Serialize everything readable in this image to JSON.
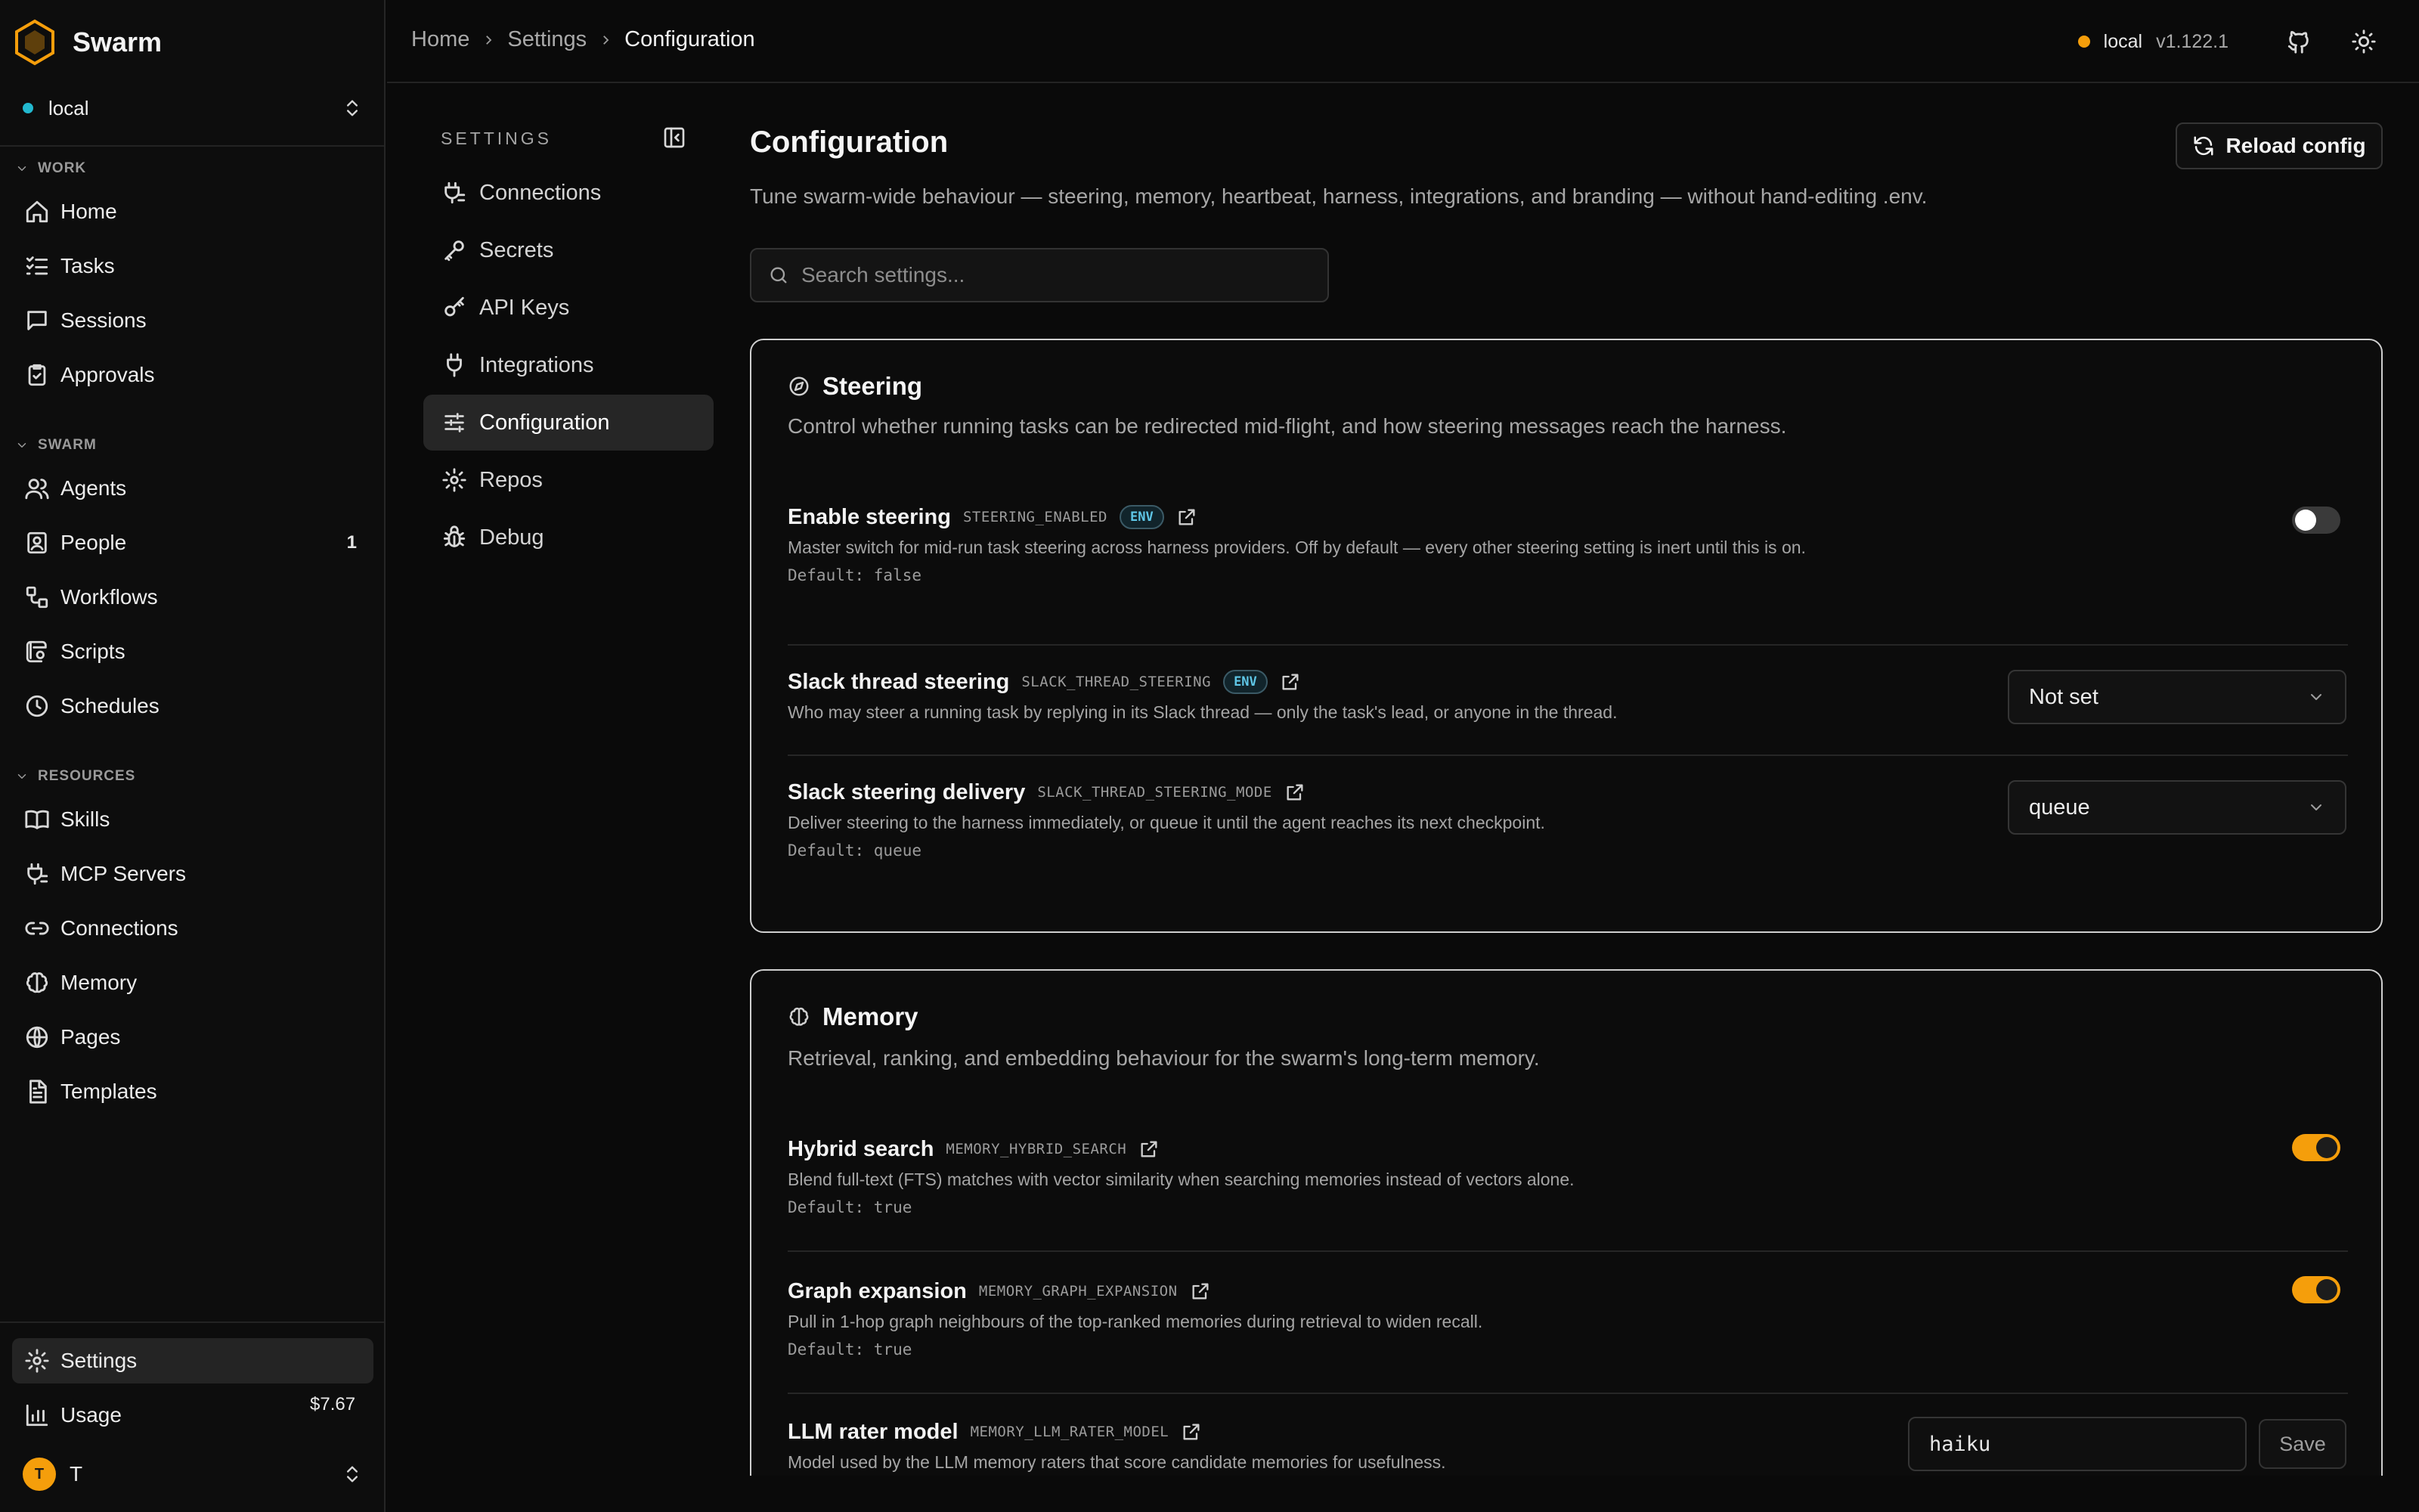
{
  "brand": {
    "name": "Swarm"
  },
  "workspace": {
    "name": "local",
    "dot_color": "#22b8cf"
  },
  "sidebar": {
    "sections": {
      "work": "WORK",
      "swarm": "SWARM",
      "resources": "RESOURCES"
    },
    "work": [
      {
        "label": "Home",
        "icon": "home-icon"
      },
      {
        "label": "Tasks",
        "icon": "tasks-icon"
      },
      {
        "label": "Sessions",
        "icon": "message-icon"
      },
      {
        "label": "Approvals",
        "icon": "clipboard-icon"
      }
    ],
    "swarm": [
      {
        "label": "Agents",
        "icon": "users-icon"
      },
      {
        "label": "People",
        "icon": "contact-icon",
        "count": "1"
      },
      {
        "label": "Workflows",
        "icon": "workflow-icon"
      },
      {
        "label": "Scripts",
        "icon": "script-icon"
      },
      {
        "label": "Schedules",
        "icon": "clock-icon"
      }
    ],
    "resources": [
      {
        "label": "Skills",
        "icon": "book-icon"
      },
      {
        "label": "MCP Servers",
        "icon": "plug-icon"
      },
      {
        "label": "Connections",
        "icon": "link-icon"
      },
      {
        "label": "Memory",
        "icon": "brain-icon"
      },
      {
        "label": "Pages",
        "icon": "globe-icon"
      },
      {
        "label": "Templates",
        "icon": "document-icon"
      }
    ],
    "bottom": {
      "settings": "Settings",
      "usage": "Usage",
      "usage_cost": "$7.67",
      "user_initial": "T",
      "user_name": "T"
    }
  },
  "topbar": {
    "breadcrumbs": [
      "Home",
      "Settings",
      "Configuration"
    ],
    "env_label": "local",
    "env_dot_color": "#f59e0b",
    "version": "v1.122.1"
  },
  "settings_nav": {
    "heading": "SETTINGS",
    "items": [
      {
        "label": "Connections",
        "icon": "plug-icon"
      },
      {
        "label": "Secrets",
        "icon": "key-icon"
      },
      {
        "label": "API Keys",
        "icon": "key-round-icon"
      },
      {
        "label": "Integrations",
        "icon": "plug-icon"
      },
      {
        "label": "Configuration",
        "icon": "sliders-icon",
        "active": true
      },
      {
        "label": "Repos",
        "icon": "gear-icon"
      },
      {
        "label": "Debug",
        "icon": "bug-icon"
      }
    ]
  },
  "main": {
    "title": "Configuration",
    "subtitle": "Tune swarm-wide behaviour — steering, memory, heartbeat, harness, integrations, and branding — without hand-editing .env.",
    "reload_label": "Reload config",
    "search_placeholder": "Search settings..."
  },
  "steering": {
    "title": "Steering",
    "description": "Control whether running tasks can be redirected mid-flight, and how steering messages reach the harness.",
    "rows": [
      {
        "name": "Enable steering",
        "key": "STEERING_ENABLED",
        "badge": "ENV",
        "description": "Master switch for mid-run task steering across harness providers. Off by default — every other steering setting is inert until this is on.",
        "default": "Default: false",
        "enabled": false
      },
      {
        "name": "Slack thread steering",
        "key": "SLACK_THREAD_STEERING",
        "badge": "ENV",
        "description": "Who may steer a running task by replying in its Slack thread — only the task's lead, or anyone in the thread.",
        "value": "Not set"
      },
      {
        "name": "Slack steering delivery",
        "key": "SLACK_THREAD_STEERING_MODE",
        "description": "Deliver steering to the harness immediately, or queue it until the agent reaches its next checkpoint.",
        "default": "Default: queue",
        "value": "queue"
      }
    ]
  },
  "memory": {
    "title": "Memory",
    "description": "Retrieval, ranking, and embedding behaviour for the swarm's long-term memory.",
    "rows": [
      {
        "name": "Hybrid search",
        "key": "MEMORY_HYBRID_SEARCH",
        "description": "Blend full-text (FTS) matches with vector similarity when searching memories instead of vectors alone.",
        "default": "Default: true",
        "enabled": true
      },
      {
        "name": "Graph expansion",
        "key": "MEMORY_GRAPH_EXPANSION",
        "description": "Pull in 1-hop graph neighbours of the top-ranked memories during retrieval to widen recall.",
        "default": "Default: true",
        "enabled": true
      },
      {
        "name": "LLM rater model",
        "key": "MEMORY_LLM_RATER_MODEL",
        "description": "Model used by the LLM memory raters that score candidate memories for usefulness.",
        "value": "haiku",
        "save_label": "Save"
      }
    ]
  },
  "colors": {
    "accent": "#f59e0b",
    "env_badge": "#5fc6e6"
  }
}
